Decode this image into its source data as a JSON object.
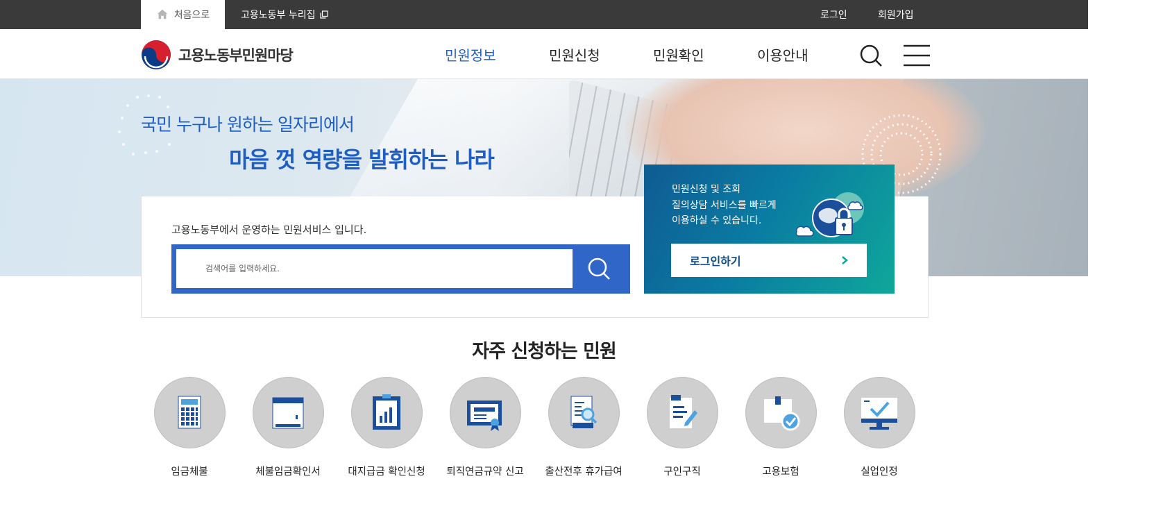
{
  "topbar": {
    "home_label": "처음으로",
    "nuri_label": "고용노동부 누리집",
    "login_label": "로그인",
    "signup_label": "회원가입"
  },
  "header": {
    "logo_text": "고용노동부민원마당",
    "menu": [
      "민원정보",
      "민원신청",
      "민원확인",
      "이용안내"
    ],
    "active_menu": "민원정보"
  },
  "hero": {
    "line1": "국민 누구나 원하는 일자리에서",
    "line2": "마음 껏 역량을 발휘하는 나라"
  },
  "search": {
    "description": "고용노동부에서 운영하는 민원서비스 입니다.",
    "placeholder": "검색어를 입력하세요."
  },
  "login_card": {
    "lines": [
      "민원신청 및 조회",
      "질의상담 서비스를 빠르게",
      "이용하실 수 있습니다."
    ],
    "button_label": "로그인하기"
  },
  "frequent": {
    "title": "자주 신청하는 민원",
    "items": [
      {
        "label": "임금체불",
        "icon": "calculator-icon"
      },
      {
        "label": "체불임금확인서",
        "icon": "document-box-icon"
      },
      {
        "label": "대지급금 확인신청",
        "icon": "chart-report-icon"
      },
      {
        "label": "퇴직연금규약 신고",
        "icon": "certificate-icon"
      },
      {
        "label": "출산전후 휴가급여",
        "icon": "document-search-icon"
      },
      {
        "label": "구인구직",
        "icon": "document-edit-icon"
      },
      {
        "label": "고용보험",
        "icon": "insurance-check-icon"
      },
      {
        "label": "실업인정",
        "icon": "monitor-check-icon"
      }
    ]
  },
  "colors": {
    "accent": "#1f5fc4",
    "topbar": "#3a3a3a",
    "search_border": "#2f66c8",
    "icon_circle": "#cfcfcf"
  }
}
